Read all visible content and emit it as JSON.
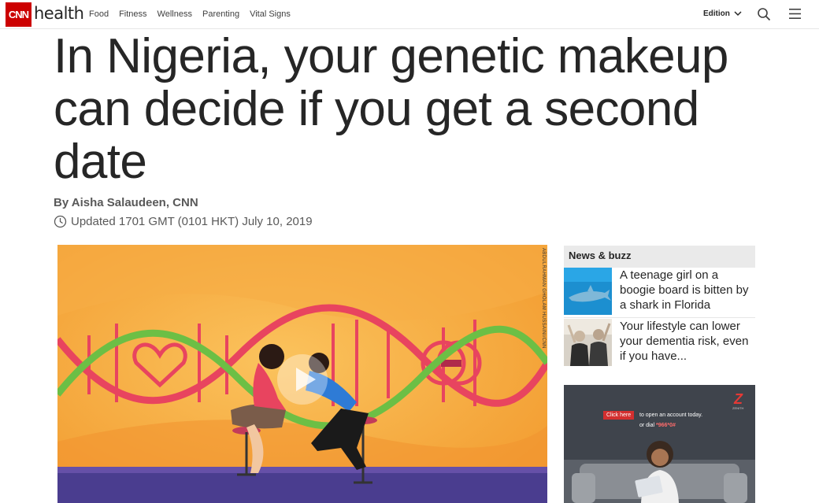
{
  "nav": {
    "logo": "CNN",
    "section": "health",
    "links": [
      "Food",
      "Fitness",
      "Wellness",
      "Parenting",
      "Vital Signs"
    ],
    "edition_label": "Edition",
    "icons": [
      "search-icon",
      "menu-icon",
      "chevron-down-icon"
    ]
  },
  "article": {
    "headline": "In Nigeria, your genetic makeup can decide if you get a second date",
    "byline": "By Aisha Salaudeen, CNN",
    "updated": "Updated 1701 GMT (0101 HKT) July 10, 2019",
    "video_credit": "ABDULRAHMAN GHOLAM HUSSAINI/CNN"
  },
  "sidebar": {
    "header": "News & buzz",
    "items": [
      {
        "text": "A teenage girl on a boogie board is bitten by a shark in Florida"
      },
      {
        "text": "Your lifestyle can lower your dementia risk, even if you have..."
      }
    ]
  },
  "ad": {
    "brand": "Z",
    "brand_sub": "ZENITH",
    "button": "Click here",
    "line1": "to open an account today.",
    "line2_prefix": "or dial ",
    "dial_code": "*966*0#"
  },
  "colors": {
    "brand_red": "#cc0000",
    "headline": "#262626",
    "meta": "#595959",
    "video_bg": "#f5a53a"
  }
}
